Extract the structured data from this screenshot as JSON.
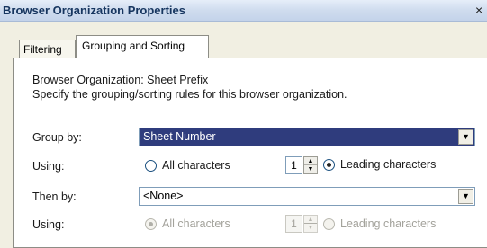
{
  "window": {
    "title": "Browser Organization Properties",
    "close_glyph": "×"
  },
  "tabs": [
    {
      "label": "Filtering",
      "selected": false
    },
    {
      "label": "Grouping and Sorting",
      "selected": true
    }
  ],
  "panel": {
    "org_line": "Browser Organization: Sheet Prefix",
    "description": "Specify the grouping/sorting rules for this browser organization."
  },
  "group_by": {
    "label": "Group by:",
    "value": "Sheet Number",
    "dropdown_glyph": "▼",
    "using_label": "Using:",
    "all_characters_label": "All characters",
    "all_characters_selected": false,
    "leading_count": "1",
    "leading_characters_label": "Leading characters",
    "leading_characters_selected": true
  },
  "then_by": {
    "label": "Then by:",
    "value": "<None>",
    "dropdown_glyph": "▼",
    "using_label": "Using:",
    "all_characters_label": "All characters",
    "all_characters_selected": true,
    "leading_count": "1",
    "leading_characters_label": "Leading characters",
    "leading_characters_selected": false,
    "disabled": true
  },
  "spin_glyphs": {
    "up": "▲",
    "down": "▼"
  },
  "colors": {
    "title_text": "#16355f",
    "selected_combo_bg": "#2f3c7d",
    "dialog_bg": "#f1efe2"
  }
}
